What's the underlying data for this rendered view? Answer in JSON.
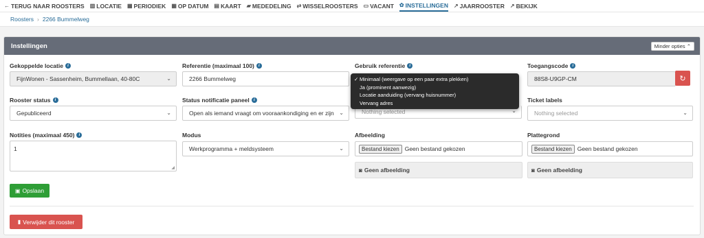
{
  "nav": [
    {
      "icon": "←",
      "label": "TERUG NAAR ROOSTERS",
      "name": "back-to-roosters-icon"
    },
    {
      "icon": "▥",
      "label": "LOCATIE",
      "name": "building-icon"
    },
    {
      "icon": "▦",
      "label": "PERIODIEK",
      "name": "calendar-icon"
    },
    {
      "icon": "▦",
      "label": "OP DATUM",
      "name": "calendar-date-icon"
    },
    {
      "icon": "▤",
      "label": "KAART",
      "name": "map-icon"
    },
    {
      "icon": "▰",
      "label": "MEDEDELING",
      "name": "comment-icon"
    },
    {
      "icon": "⇄",
      "label": "WISSELROOSTERS",
      "name": "swap-icon"
    },
    {
      "icon": "▭",
      "label": "VACANT",
      "name": "vacant-icon"
    },
    {
      "icon": "✿",
      "label": "INSTELLINGEN",
      "name": "gear-icon"
    },
    {
      "icon": "↗",
      "label": "JAARROOSTER",
      "name": "external-link-icon"
    },
    {
      "icon": "↗",
      "label": "BEKIJK",
      "name": "external-link-icon-2"
    }
  ],
  "breadcrumb": {
    "root": "Roosters",
    "separator": "›",
    "current": "2266 Bummelweg"
  },
  "panel": {
    "title": "Instellingen",
    "options_button": "Minder opties ⌃"
  },
  "fields": {
    "linked_location": {
      "label": "Gekoppelde locatie",
      "value": "FijnWonen - Sassenheim, Bummellaan, 40-80C"
    },
    "reference": {
      "label": "Referentie (maximaal 100)",
      "value": "2266 Bummelweg"
    },
    "use_reference": {
      "label": "Gebruik referentie",
      "value": "Nothing selected"
    },
    "access_code": {
      "label": "Toegangscode",
      "value": "88S8-U9GP-CM"
    },
    "status": {
      "label": "Rooster status",
      "value": "Gepubliceerd"
    },
    "notification_panel": {
      "label": "Status notificatie paneel",
      "value": "Open als iemand vraagt om vooraankondiging en er zijn"
    },
    "ticket_labels": {
      "label": "Ticket labels",
      "placeholder": "Nothing selected"
    },
    "notes": {
      "label": "Notities (maximaal 450)",
      "value": "1"
    },
    "mode": {
      "label": "Modus",
      "value": "Werkprogramma + meldsysteem"
    },
    "image": {
      "label": "Afbeelding",
      "button": "Bestand kiezen",
      "status": "Geen bestand gekozen",
      "empty": "Geen afbeelding"
    },
    "floorplan": {
      "label": "Plattegrond",
      "button": "Bestand kiezen",
      "status": "Geen bestand gekozen",
      "empty": "Geen afbeelding"
    }
  },
  "dropdown": {
    "items": [
      {
        "label": "Minimaal (weergave op een paar extra plekken)",
        "checked": "✓"
      },
      {
        "label": "Ja (prominent aanwezig)",
        "checked": ""
      },
      {
        "label": "Locatie aanduiding (vervang huisnummer)",
        "checked": ""
      },
      {
        "label": "Vervang adres",
        "checked": ""
      }
    ]
  },
  "actions": {
    "save": "Opslaan",
    "delete": "Verwijder dit rooster"
  },
  "colors": {
    "accent": "#2a6d99",
    "header": "#666c78",
    "save": "#2e9e36",
    "danger": "#d9534f"
  }
}
